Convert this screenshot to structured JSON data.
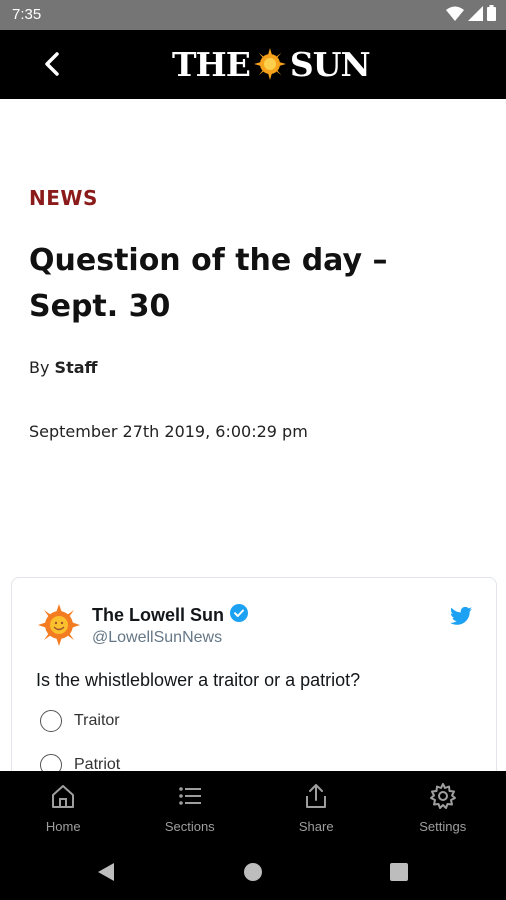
{
  "status_bar": {
    "time": "7:35"
  },
  "header": {
    "logo_left": "THE",
    "logo_right": "SUN"
  },
  "article": {
    "section": "NEWS",
    "headline": "Question of the day – Sept. 30",
    "byline_prefix": "By",
    "author": "Staff",
    "date": "September 27th 2019, 6:00:29 pm"
  },
  "tweet": {
    "name": "The Lowell Sun",
    "handle": "@LowellSunNews",
    "text": "Is the whistleblower a traitor or a patriot?",
    "options": [
      "Traitor",
      "Patriot"
    ]
  },
  "bottom_nav": {
    "items": [
      {
        "label": "Home",
        "icon": "home-icon"
      },
      {
        "label": "Sections",
        "icon": "list-icon"
      },
      {
        "label": "Share",
        "icon": "share-icon"
      },
      {
        "label": "Settings",
        "icon": "gear-icon"
      }
    ]
  },
  "colors": {
    "section_accent": "#8b1a1a",
    "header_bg": "#000000",
    "twitter_blue": "#1da1f2",
    "sun_orange": "#f7a21b"
  }
}
